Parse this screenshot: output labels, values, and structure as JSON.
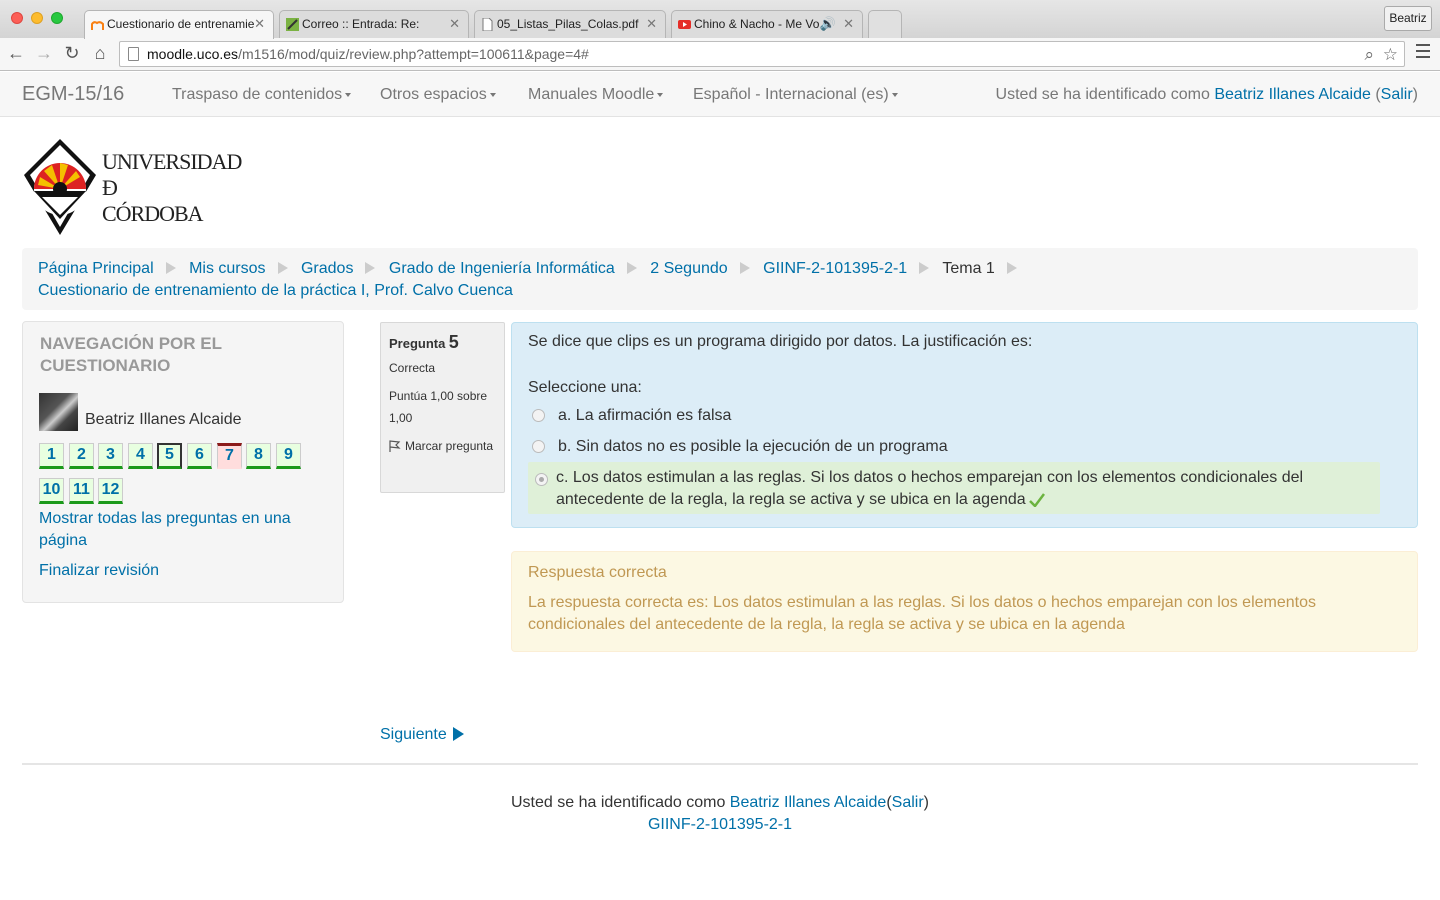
{
  "browser": {
    "tabs": [
      {
        "title": "Cuestionario de entrenamie",
        "favicon": "moodle-icon",
        "active": true
      },
      {
        "title": "Correo :: Entrada: Re:",
        "favicon": "mail-icon",
        "active": false
      },
      {
        "title": "05_Listas_Pilas_Colas.pdf",
        "favicon": "document-icon",
        "active": false
      },
      {
        "title": "Chino & Nacho - Me Vo",
        "favicon": "youtube-icon",
        "active": false
      }
    ],
    "profile": "Beatriz",
    "url_host": "moodle.uco.es",
    "url_path": "/m1516/mod/quiz/review.php?attempt=100611&page=4#"
  },
  "navbar": {
    "brand": "EGM-15/16",
    "menu": [
      "Traspaso de contenidos",
      "Otros espacios",
      "Manuales Moodle",
      "Español - Internacional (es)"
    ],
    "login_prefix": "Usted se ha identificado como ",
    "user": "Beatriz Illanes Alcaide",
    "logout": "Salir"
  },
  "logo": {
    "line1": "UNIVERSIDAD",
    "line2": "Ð",
    "line3": "CÓRDOBA"
  },
  "breadcrumb": {
    "items": [
      "Página Principal",
      "Mis cursos",
      "Grados",
      "Grado de Ingeniería Informática",
      "2 Segundo",
      "GIINF-2-101395-2-1",
      "Tema 1"
    ],
    "last": "Cuestionario de entrenamiento de la práctica I, Prof. Calvo Cuenca"
  },
  "quiz_nav": {
    "title": "NAVEGACIÓN POR EL CUESTIONARIO",
    "user": "Beatriz Illanes Alcaide",
    "buttons": [
      "1",
      "2",
      "3",
      "4",
      "5",
      "6",
      "7",
      "8",
      "9",
      "10",
      "11",
      "12"
    ],
    "current": "5",
    "incorrect": "7",
    "show_all": "Mostrar todas las preguntas en una página",
    "finish": "Finalizar revisión"
  },
  "question_info": {
    "label": "Pregunta",
    "number": "5",
    "state": "Correcta",
    "grade": "Puntúa 1,00 sobre 1,00",
    "flag": "Marcar pregunta"
  },
  "question": {
    "text": "Se dice que clips es un programa dirigido por datos. La justificación es:",
    "prompt": "Seleccione una:",
    "options": [
      "a. La afirmación es falsa",
      "b. Sin datos no es posible la ejecución de un programa",
      "c. Los datos estimulan a las reglas. Si los datos o hechos emparejan con los elementos condicionales del antecedente de la regla, la regla se activa y se ubica en la agenda"
    ],
    "selected": "c"
  },
  "feedback": {
    "title": "Respuesta correcta",
    "body": "La respuesta correcta es: Los datos estimulan a las reglas. Si los datos o hechos emparejan con los elementos condicionales del antecedente de la regla, la regla se activa y se ubica en la agenda"
  },
  "next": "Siguiente",
  "footer": {
    "prefix": "Usted se ha identificado como ",
    "user": "Beatriz Illanes Alcaide",
    "logout": "Salir",
    "course": "GIINF-2-101395-2-1"
  },
  "colors": {
    "link": "#0070a8",
    "correct_bg": "#dff0d8",
    "info_bg": "#dcedf7",
    "feedback_text": "#c09853",
    "answered_bar": "#1b9a1b",
    "wrong_bar": "#8b1a1a"
  }
}
